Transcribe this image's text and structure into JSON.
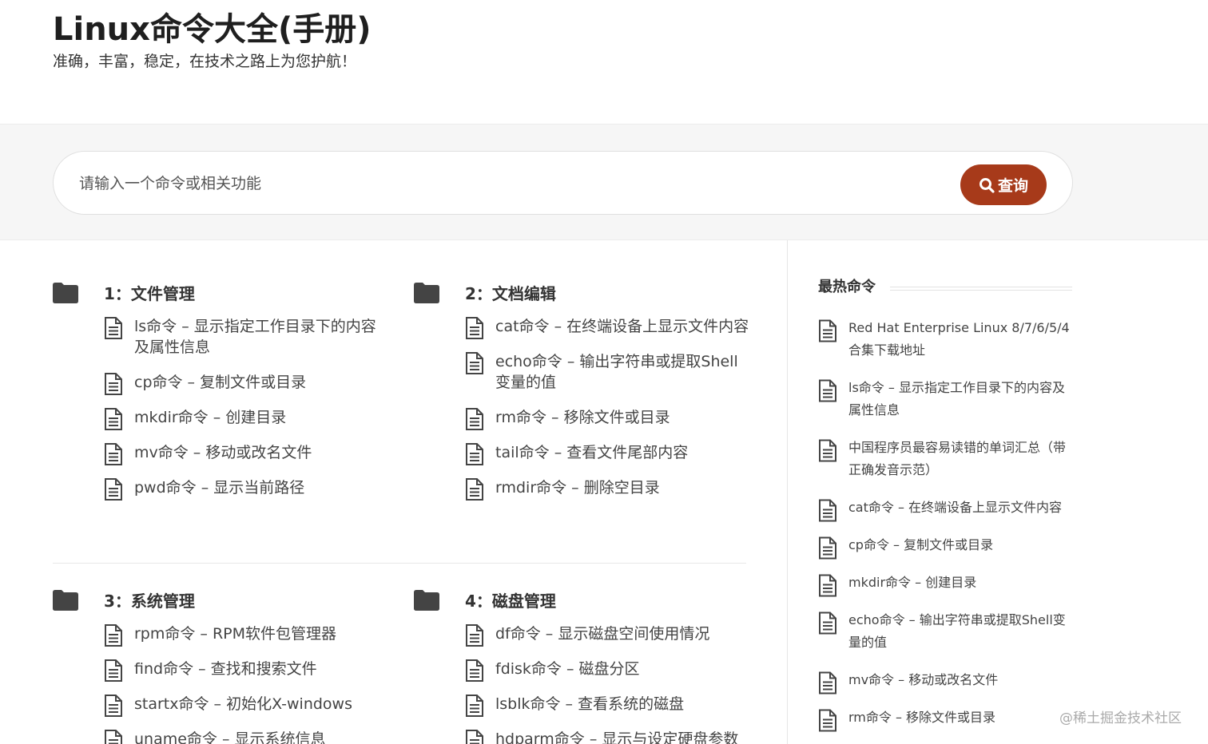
{
  "header": {
    "title": "Linux命令大全(手册)",
    "tagline": "准确，丰富，稳定，在技术之路上为您护航！"
  },
  "search": {
    "placeholder": "请输入一个命令或相关功能",
    "button_label": "查询"
  },
  "categories": [
    {
      "title": "1：文件管理",
      "items": [
        "ls命令 – 显示指定工作目录下的内容及属性信息",
        "cp命令 – 复制文件或目录",
        "mkdir命令 – 创建目录",
        "mv命令 – 移动或改名文件",
        "pwd命令 – 显示当前路径"
      ]
    },
    {
      "title": "2：文档编辑",
      "items": [
        "cat命令 – 在终端设备上显示文件内容",
        "echo命令 – 输出字符串或提取Shell变量的值",
        "rm命令 – 移除文件或目录",
        "tail命令 – 查看文件尾部内容",
        "rmdir命令 – 删除空目录"
      ]
    },
    {
      "title": "3：系统管理",
      "items": [
        "rpm命令 – RPM软件包管理器",
        "find命令 – 查找和搜索文件",
        "startx命令 – 初始化X-windows",
        "uname命令 – 显示系统信息"
      ]
    },
    {
      "title": "4：磁盘管理",
      "items": [
        "df命令 – 显示磁盘空间使用情况",
        "fdisk命令 – 磁盘分区",
        "lsblk命令 – 查看系统的磁盘",
        "hdparm命令 – 显示与设定硬盘参数"
      ]
    }
  ],
  "sidebar": {
    "title": "最热命令",
    "items": [
      "Red Hat Enterprise Linux 8/7/6/5/4 合集下载地址",
      "ls命令 – 显示指定工作目录下的内容及属性信息",
      "中国程序员最容易读错的单词汇总（带正确发音示范）",
      "cat命令 – 在终端设备上显示文件内容",
      "cp命令 – 复制文件或目录",
      "mkdir命令 – 创建目录",
      "echo命令 – 输出字符串或提取Shell变量的值",
      "mv命令 – 移动或改名文件",
      "rm命令 – 移除文件或目录"
    ]
  },
  "watermark": "@稀土掘金技术社区",
  "colors": {
    "accent": "#a73a1a",
    "band": "#f6f6f6",
    "text": "#333333",
    "icon": "#444444"
  }
}
